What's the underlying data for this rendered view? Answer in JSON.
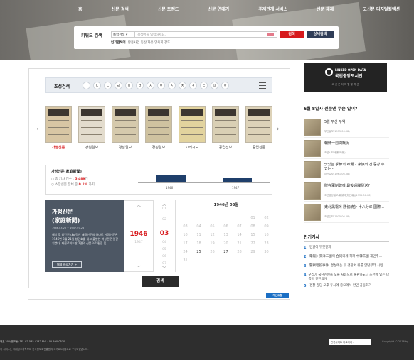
{
  "nav": [
    "홈",
    "신문 검색",
    "신문 트렌드",
    "신문 연대기",
    "주제관계 서비스",
    "신문 체제",
    "고신문 디지털컬렉션"
  ],
  "search": {
    "label": "키워드 검색",
    "scope": "통합검색",
    "placeholder": "검색어를 입력하세요.",
    "search_btn": "검색",
    "detail_btn": "상세검색",
    "popular_label": "인기검색어",
    "popular_terms": "황용사건  동산  자유  앙육회  강도"
  },
  "chosung": {
    "title": "초성검색",
    "letters": [
      "ㄱ",
      "ㄴ",
      "ㄷ",
      "ㄹ",
      "ㅁ",
      "ㅂ",
      "ㅅ",
      "ㅇ",
      "ㅈ",
      "ㅊ",
      "ㅋ",
      "ㅌ",
      "ㅍ",
      "ㅎ"
    ]
  },
  "papers": [
    "가정신문",
    "강원일보",
    "경남일보",
    "경성일보",
    "고려시보",
    "공립신보",
    "공업신문"
  ],
  "selected": {
    "name": "가정신문(家庭新聞)",
    "total_label": "총 기사 건수 :",
    "total_value": "5,489",
    "total_unit": "건",
    "ratio_label": "소장신문 전체 중",
    "ratio_value": "0.1%",
    "ratio_unit": "차지",
    "title1": "가정신문",
    "title2": "(家庭新聞)",
    "dates": "1946.03.25 ~ 1947.07.26",
    "desc": "해방 후 창간된 대표적인 대중신문의 하나로 가정신문은 1946년 3월 21일 창간호를 내고 출발한 여성전문 일간지였다. 타블로이드판 2면의 신문으로 편집 및…",
    "go_btn": "매체 바로가기 >",
    "chart": {
      "years": [
        "1946",
        "1947"
      ],
      "values": [
        0.9,
        0.6
      ]
    }
  },
  "picker": {
    "year": "1946",
    "year_next": "1947",
    "month": "03",
    "months_prev": [
      "01",
      "02"
    ],
    "months_next": [
      "04",
      "05",
      "06",
      "07"
    ],
    "cal_title": "1946년 03월",
    "rows": [
      [
        "",
        "",
        "",
        "",
        "",
        "01",
        "02"
      ],
      [
        "03",
        "04",
        "05",
        "06",
        "07",
        "08",
        "09"
      ],
      [
        "10",
        "11",
        "12",
        "13",
        "14",
        "15",
        "16"
      ],
      [
        "17",
        "18",
        "19",
        "20",
        "21",
        "22",
        "23"
      ],
      [
        "24",
        "25",
        "26",
        "27",
        "28",
        "29",
        "30"
      ],
      [
        "31",
        "",
        "",
        "",
        "",
        "",
        ""
      ]
    ],
    "active_days": [
      "25",
      "27"
    ],
    "go": "검색"
  },
  "feedback": "개선요청",
  "banner": {
    "a": "LINKED OPEN DATA",
    "b": "국립중앙도서관",
    "c": "고 신 문 디 지 털 컬 렉 션"
  },
  "question": {
    "title": "6월 8일자 신문엔 무슨 일이?",
    "items": [
      {
        "headline": "5월 부산 무역",
        "source": "부산일보(1955.06.08)"
      },
      {
        "headline": "朝鮮一週間概況",
        "source": "조선시보(朝鮮時報)"
      },
      {
        "headline": "맛있는 季節의 味覺 - 家族의 건 중강 수 었는 -",
        "source": "마산일보(1961.06.08)"
      },
      {
        "headline": "財在軍制建에 最後通牒發送?",
        "source": "조선중앙일보(朝鮮中央日報)(1935.06.08)"
      },
      {
        "headline": "東北黑電에 勝協統計 十八分로 國際…",
        "source": "조선일보(1935.06.08)"
      }
    ]
  },
  "popular_articles": {
    "title": "인기기사",
    "items": [
      "민권이 무엇인지",
      "電報): 東洋三國이 合同되게 히려 中韓未國 재민주…",
      "警察暗殺事件, 경성에는 두 경찰서 위를 암담부터 시민",
      "우리가 국난진면을 오늘 처음으로 출판하노니 조선에 있는 나쁨이 인민의게",
      "경찰 강당 오후 두시에 중요에서 만민 공동회가"
    ]
  },
  "footer": {
    "addr": "대표 201(면포동)      TEL 02-535-4142      FAX : 02-590-0530",
    "note": "이 서비스는 미래창조과학부와 한국정보화진흥원의 국가DB사업으로 구축되었습니다.",
    "select": "관련사이트 바로가기",
    "copyright": "Copyright © 2016 by"
  }
}
